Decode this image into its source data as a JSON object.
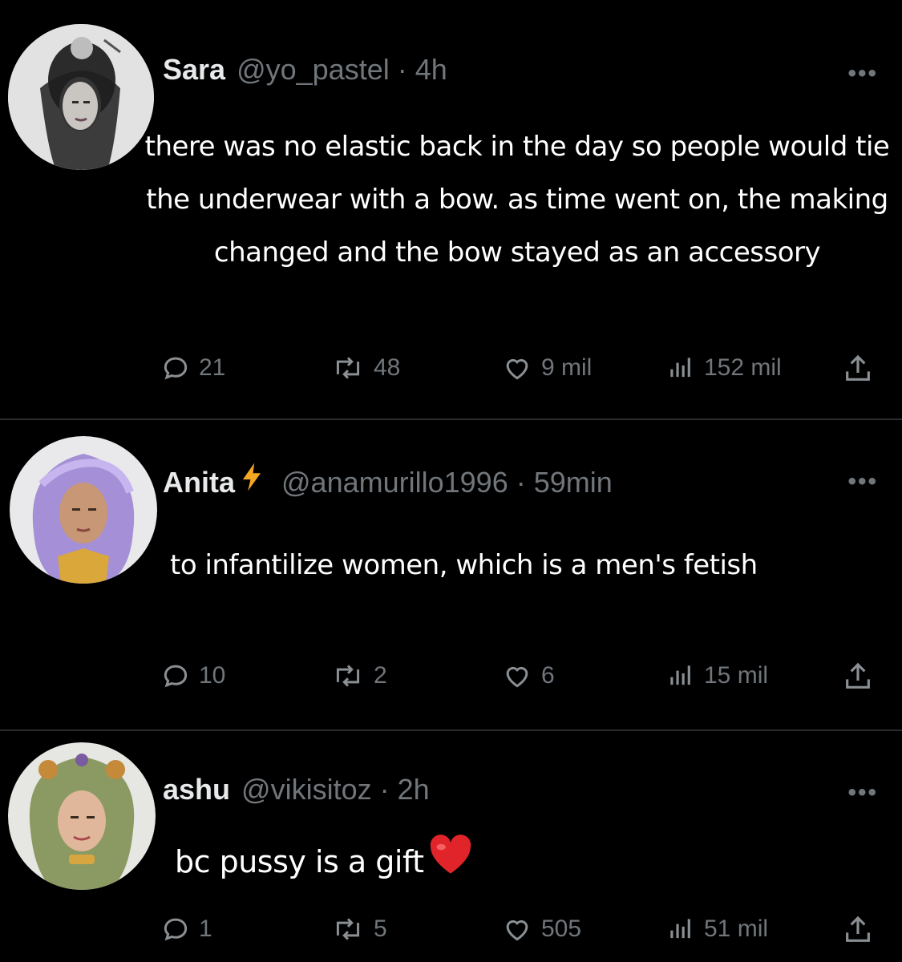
{
  "posts": [
    {
      "name": "Sara",
      "handle": "@yo_pastel · 4h",
      "more": "•••",
      "text": "there was no elastic back in the day so people would tie the underwear with a bow. as time went on, the making changed and the bow stayed as an accessory",
      "replies": "21",
      "reposts": "48",
      "likes": "9 mil",
      "views": "152 mil"
    },
    {
      "name": "Anita",
      "handle": "@anamurillo1996 · 59min",
      "more": "•••",
      "text": "to infantilize women, which is a men's fetish",
      "replies": "10",
      "reposts": "2",
      "likes": "6",
      "views": "15 mil"
    },
    {
      "name": "ashu",
      "handle": "@vikisitoz · 2h",
      "more": "•••",
      "text": "bc pussy is a gift",
      "replies": "1",
      "reposts": "5",
      "likes": "505",
      "views": "51 mil"
    }
  ],
  "colors": {
    "background": "#000000",
    "text": "#ffffff",
    "muted": "#71767b",
    "divider": "#2a2d30",
    "bolt": "#f5a623",
    "heart": "#e0242a"
  }
}
